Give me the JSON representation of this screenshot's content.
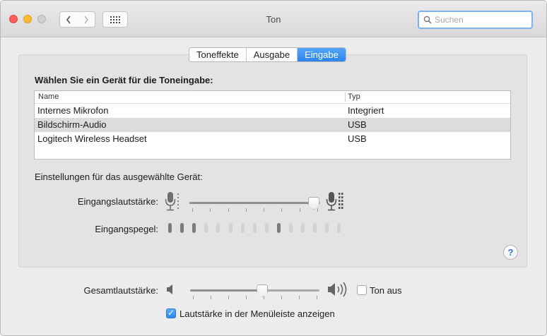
{
  "window": {
    "title": "Ton"
  },
  "search": {
    "placeholder": "Suchen"
  },
  "tabs": [
    {
      "label": "Toneffekte",
      "selected": false
    },
    {
      "label": "Ausgabe",
      "selected": false
    },
    {
      "label": "Eingabe",
      "selected": true
    }
  ],
  "input_panel": {
    "heading": "Wählen Sie ein Gerät für die Toneingabe:",
    "table": {
      "columns": [
        "Name",
        "Typ"
      ],
      "rows": [
        {
          "name": "Internes Mikrofon",
          "type": "Integriert",
          "selected": false
        },
        {
          "name": "Bildschirm-Audio",
          "type": "USB",
          "selected": true
        },
        {
          "name": "Logitech Wireless Headset",
          "type": "USB",
          "selected": false
        }
      ]
    },
    "device_settings_label": "Einstellungen für das ausgewählte Gerät:",
    "input_volume": {
      "label": "Eingangslautstärke:",
      "value": 0.95
    },
    "input_level": {
      "label": "Eingangspegel:",
      "total_bars": 15,
      "active_bars": [
        1,
        2,
        3,
        10
      ]
    }
  },
  "output_volume": {
    "label": "Gesamtlautstärke:",
    "value": 0.56
  },
  "mute": {
    "label": "Ton aus",
    "checked": false
  },
  "menubar_volume": {
    "label": "Lautstärke in der Menüleiste anzeigen",
    "checked": true
  },
  "colors": {
    "accent": "#2b84ee",
    "search_focus": "#7fb1ea",
    "close": "#fc5f57",
    "minimize": "#fdbc2e"
  }
}
